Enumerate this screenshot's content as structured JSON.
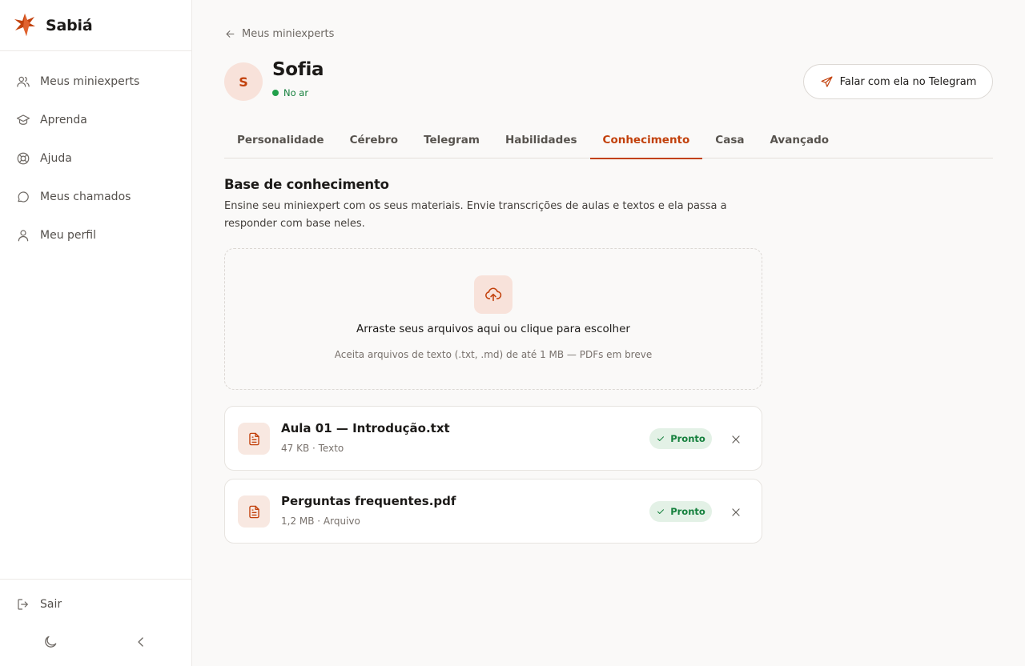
{
  "brand": {
    "name": "Sabiá",
    "color": "#c2410c"
  },
  "sidebar": {
    "items": [
      {
        "label": "Meus miniexperts",
        "icon": "users-icon"
      },
      {
        "label": "Aprenda",
        "icon": "graduation-cap-icon"
      },
      {
        "label": "Ajuda",
        "icon": "lifebuoy-icon"
      },
      {
        "label": "Meus chamados",
        "icon": "chat-bubble-icon"
      },
      {
        "label": "Meu perfil",
        "icon": "user-icon"
      }
    ],
    "logout_label": "Sair",
    "theme_icon": "moon-icon",
    "collapse_icon": "chevron-left-icon"
  },
  "header": {
    "back_label": "Meus miniexperts",
    "avatar_initial": "S",
    "agent_name": "Sofia",
    "status": "No ar",
    "telegram_button": "Falar com ela no Telegram"
  },
  "tabs": [
    {
      "label": "Personalidade",
      "active": false
    },
    {
      "label": "Cérebro",
      "active": false
    },
    {
      "label": "Telegram",
      "active": false
    },
    {
      "label": "Habilidades",
      "active": false
    },
    {
      "label": "Conhecimento",
      "active": true
    },
    {
      "label": "Casa",
      "active": false
    },
    {
      "label": "Avançado",
      "active": false
    }
  ],
  "knowledge": {
    "title": "Base de conhecimento",
    "description": "Ensine seu miniexpert com os seus materiais. Envie transcrições de aulas e textos e ela passa a responder com base neles.",
    "dropzone_title": "Arraste seus arquivos aqui ou clique para escolher",
    "dropzone_hint": "Aceita arquivos de texto (.txt, .md) de até 1 MB — PDFs em breve",
    "files": [
      {
        "name": "Aula 01 — Introdução.txt",
        "meta": "47 KB · Texto",
        "status": "Pronto"
      },
      {
        "name": "Perguntas frequentes.pdf",
        "meta": "1,2 MB · Arquivo",
        "status": "Pronto"
      }
    ]
  },
  "colors": {
    "accent": "#c2410c",
    "success": "#15803d",
    "background": "#faf9f8"
  }
}
